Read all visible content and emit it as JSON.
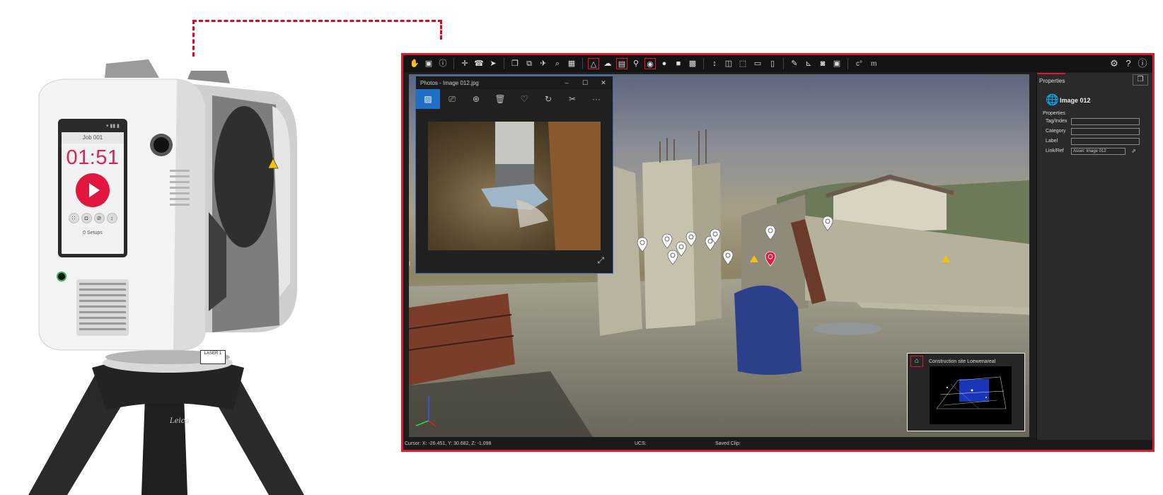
{
  "scanner": {
    "screen": {
      "job": "Job 001",
      "time": "01:51",
      "setups": "0 Setups"
    },
    "label_laser": "LASER 1",
    "brand": "Leica"
  },
  "toolbar": {
    "measure_label": "m",
    "degree_label": "c°"
  },
  "photos_window": {
    "title": "Photos - Image 012.jpg",
    "min": "–",
    "max": "☐",
    "close": "✕"
  },
  "minimap": {
    "title": "Construction site Loewenareal"
  },
  "properties": {
    "tab": "Properties",
    "object_name": "Image 012",
    "section": "Properties",
    "fields": [
      {
        "label": "Tag/Index",
        "value": ""
      },
      {
        "label": "Category",
        "value": ""
      },
      {
        "label": "Label",
        "value": ""
      },
      {
        "label": "Link/Ref",
        "value": "Asset: Image 012"
      }
    ]
  },
  "status": {
    "cursor": "Cursor: X: -26.451, Y: 30.682, Z: -1.098",
    "ucs": "UCS:",
    "saved_clip": "Saved Clip:"
  },
  "colors": {
    "accent_red": "#e0192b",
    "marker_active": "#e3163f",
    "photos_active_tool": "#1f6fc8",
    "warning_yellow": "#f4c20d"
  }
}
